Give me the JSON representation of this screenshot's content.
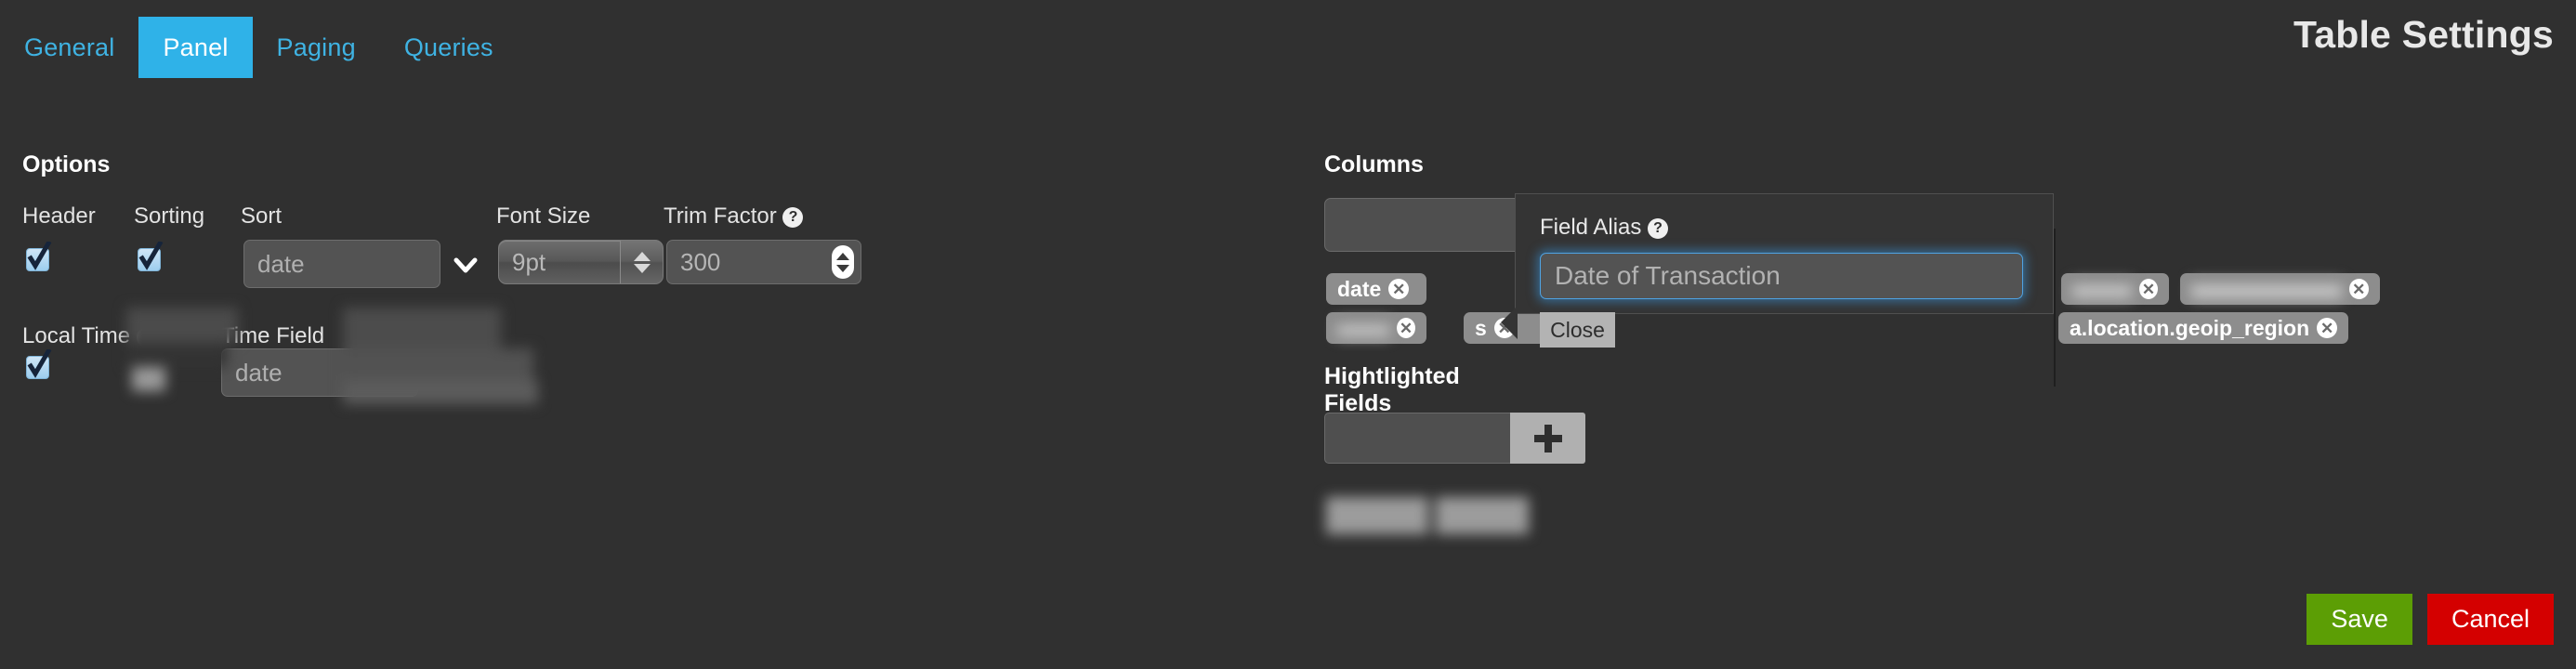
{
  "header": {
    "title": "Table Settings",
    "tabs": [
      {
        "label": "General",
        "active": false
      },
      {
        "label": "Panel",
        "active": true
      },
      {
        "label": "Paging",
        "active": false
      },
      {
        "label": "Queries",
        "active": false
      }
    ]
  },
  "options": {
    "section_title": "Options",
    "header_label": "Header",
    "header_checked": true,
    "sorting_label": "Sorting",
    "sorting_checked": true,
    "sort_label": "Sort",
    "sort_value": "date",
    "font_size_label": "Font Size",
    "font_size_value": "9pt",
    "trim_factor_label": "Trim Factor",
    "trim_factor_value": "300",
    "trim_factor_help": "?",
    "local_time_label": "Local Time",
    "local_time_help": "?",
    "local_time_checked": true,
    "time_field_label": "Time Field",
    "time_field_value": "date"
  },
  "columns": {
    "section_title": "Columns",
    "input_value": "",
    "tags": [
      {
        "label": "date",
        "redacted": false
      },
      {
        "label": "",
        "redacted": true
      },
      {
        "label": "s",
        "redacted": false
      },
      {
        "label": "",
        "redacted": true
      },
      {
        "label": "",
        "redacted": true
      },
      {
        "label": "a.location.geoip_region",
        "redacted": false
      }
    ]
  },
  "highlighted": {
    "section_title": "Hightlighted Fields",
    "input_value": "",
    "add_label": "+",
    "tags": [
      {
        "label": "",
        "redacted": true
      },
      {
        "label": "",
        "redacted": true
      }
    ]
  },
  "popup": {
    "title": "Field Alias",
    "help": "?",
    "input_value": "Date of Transaction",
    "close_label": "Close"
  },
  "footer": {
    "save_label": "Save",
    "cancel_label": "Cancel"
  },
  "colors": {
    "background": "#303030",
    "accent": "#2fb2e8",
    "save": "#5c9e05",
    "cancel": "#d40000",
    "focus_ring": "#4fa3e3"
  }
}
